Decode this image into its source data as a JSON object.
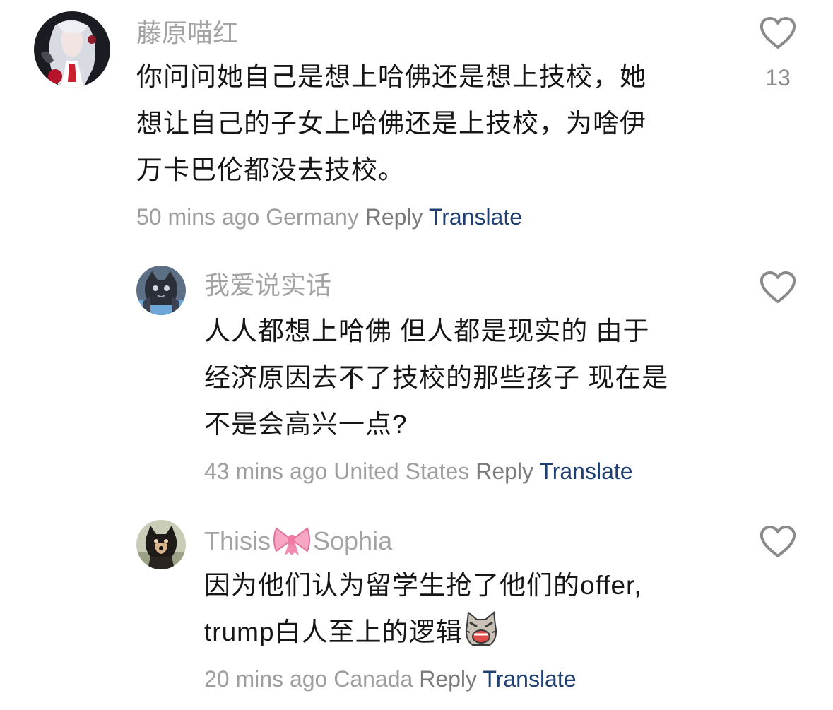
{
  "comments": [
    {
      "username": "藤原喵红",
      "lines": [
        "你问问她自己是想上哈佛还是想上技校，她",
        "想让自己的子女上哈佛还是上技校，为啥伊",
        "万卡巴伦都没去技校。"
      ],
      "time": "50 mins ago",
      "location": "Germany",
      "reply_label": "Reply",
      "translate_label": "Translate",
      "likes": "13",
      "avatar_icon": "anime-girl-avatar",
      "heart_icon": "heart-outline-icon"
    },
    {
      "username": "我爱说实话",
      "lines": [
        "人人都想上哈佛 但人都是现实的 由于",
        "经济原因去不了技校的那些孩子 现在是",
        "不是会高兴一点?"
      ],
      "time": "43 mins ago",
      "location": "United States",
      "reply_label": "Reply",
      "translate_label": "Translate",
      "avatar_icon": "dark-cat-avatar",
      "heart_icon": "heart-outline-icon"
    },
    {
      "username_prefix": "Thisis",
      "username_suffix": "Sophia",
      "username_emoji": "pink-bow-emoji",
      "lines": [
        "因为他们认为留学生抢了他们的offer,"
      ],
      "last_line_text": "trump白人至上的逻辑",
      "last_line_emoji": "crying-cat-emoji",
      "time": "20 mins ago",
      "location": "Canada",
      "reply_label": "Reply",
      "translate_label": "Translate",
      "avatar_icon": "shiba-dog-avatar",
      "heart_icon": "heart-outline-icon"
    }
  ],
  "colors": {
    "username": "#a3a3a3",
    "text": "#161616",
    "meta": "#9e9e9e",
    "translate": "#1f3f73",
    "heart": "#8a8a8a"
  }
}
